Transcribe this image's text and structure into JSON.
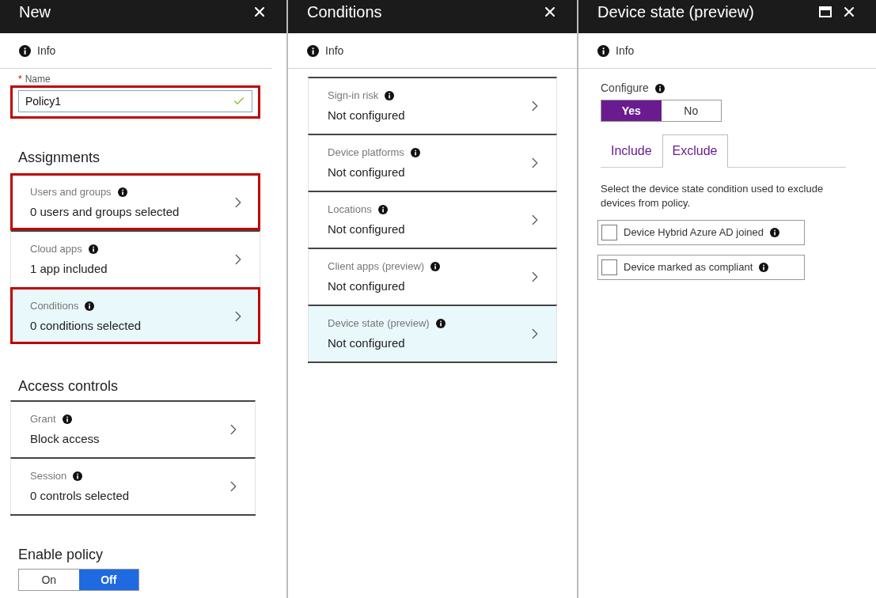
{
  "new_blade": {
    "title": "New",
    "info": "Info",
    "name_field": {
      "label": "Name",
      "required_mark": "*",
      "value": "Policy1",
      "valid": true,
      "highlighted": true
    },
    "assignments": {
      "heading": "Assignments",
      "items": [
        {
          "label": "Users and groups",
          "value": "0 users and groups selected",
          "selected": false,
          "highlighted": true
        },
        {
          "label": "Cloud apps",
          "value": "1 app included",
          "selected": false,
          "highlighted": false
        },
        {
          "label": "Conditions",
          "value": "0  conditions  selected",
          "selected": true,
          "highlighted": true
        }
      ]
    },
    "access_controls": {
      "heading": "Access controls",
      "items": [
        {
          "label": "Grant",
          "value": "Block access",
          "selected": false,
          "highlighted": false
        },
        {
          "label": "Session",
          "value": "0 controls selected",
          "selected": false,
          "highlighted": false
        }
      ]
    },
    "enable_policy": {
      "label": "Enable policy",
      "options": [
        {
          "label": "On",
          "selected": false
        },
        {
          "label": "Off",
          "selected": true
        }
      ]
    }
  },
  "conditions_blade": {
    "title": "Conditions",
    "info": "Info",
    "items": [
      {
        "label": "Sign-in risk",
        "value": "Not configured",
        "selected": false
      },
      {
        "label": "Device platforms",
        "value": "Not configured",
        "selected": false
      },
      {
        "label": "Locations",
        "value": "Not configured",
        "selected": false
      },
      {
        "label": "Client apps (preview)",
        "value": "Not configured",
        "selected": false
      },
      {
        "label": "Device state (preview)",
        "value": "Not configured",
        "selected": true
      }
    ]
  },
  "device_state_blade": {
    "title": "Device state (preview)",
    "info": "Info",
    "configure": {
      "label": "Configure",
      "options": [
        {
          "label": "Yes",
          "selected": true
        },
        {
          "label": "No",
          "selected": false
        }
      ]
    },
    "tabs": [
      {
        "label": "Include",
        "selected": false
      },
      {
        "label": "Exclude",
        "selected": true
      }
    ],
    "description": "Select the device state condition used to exclude devices from policy.",
    "checkboxes": [
      {
        "label": "Device Hybrid Azure AD joined",
        "checked": false
      },
      {
        "label": "Device marked as compliant",
        "checked": false
      }
    ]
  }
}
